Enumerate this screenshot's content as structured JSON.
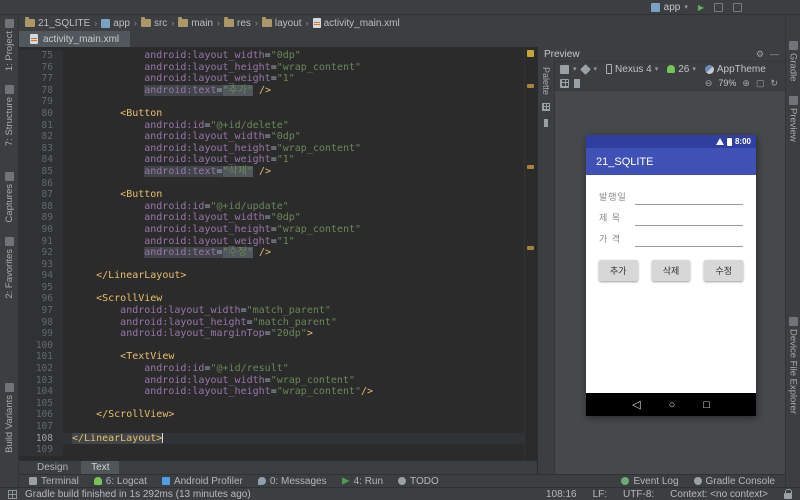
{
  "glyphs": {
    "chevron_down": "▾",
    "separator": "›",
    "play": "▶",
    "gear": "⚙",
    "minimize": "—",
    "zoom_out": "⊖",
    "zoom_in": "⊕",
    "frame": "▢",
    "refresh": "↻",
    "back": "◁",
    "home": "○",
    "recents": "□"
  },
  "top_bar": {
    "run_config": "app"
  },
  "breadcrumb": {
    "separator": "›",
    "items": [
      {
        "label": "21_SQLITE",
        "icon": "project-folder"
      },
      {
        "label": "app",
        "icon": "module"
      },
      {
        "label": "src",
        "icon": "folder"
      },
      {
        "label": "main",
        "icon": "folder"
      },
      {
        "label": "res",
        "icon": "folder"
      },
      {
        "label": "layout",
        "icon": "folder"
      },
      {
        "label": "activity_main.xml",
        "icon": "xml-file"
      }
    ]
  },
  "editor_tabs": {
    "active_tab": "activity_main.xml"
  },
  "left_stripe": {
    "top": [
      "1: Project",
      "7: Structure"
    ],
    "mid": [
      "Captures",
      "2: Favorites"
    ],
    "bottom": [
      "Build Variants"
    ]
  },
  "right_stripe": {
    "top": [
      "Gradle",
      "Preview"
    ],
    "bottom": [
      "Device File Explorer"
    ]
  },
  "editor": {
    "stripe_marks": [
      37,
      118,
      199
    ],
    "lines": [
      {
        "n": 75,
        "p": [
          [
            "i",
            12
          ],
          [
            "a",
            "android:layout_width"
          ],
          [
            "o",
            "="
          ],
          [
            "s",
            "\"0dp\""
          ]
        ]
      },
      {
        "n": 76,
        "p": [
          [
            "i",
            12
          ],
          [
            "a",
            "android:layout_height"
          ],
          [
            "o",
            "="
          ],
          [
            "s",
            "\"wrap_content\""
          ]
        ]
      },
      {
        "n": 77,
        "p": [
          [
            "i",
            12
          ],
          [
            "a",
            "android:layout_weight"
          ],
          [
            "o",
            "="
          ],
          [
            "s",
            "\"1\""
          ]
        ]
      },
      {
        "n": 78,
        "p": [
          [
            "i",
            12
          ],
          [
            "A",
            "android:text"
          ],
          [
            "O",
            "="
          ],
          [
            "S",
            "\"추가\""
          ],
          [
            "o",
            " "
          ],
          [
            "t",
            "/>"
          ]
        ]
      },
      {
        "n": 79,
        "p": []
      },
      {
        "n": 80,
        "p": [
          [
            "i",
            8
          ],
          [
            "t",
            "<Button"
          ]
        ]
      },
      {
        "n": 81,
        "p": [
          [
            "i",
            12
          ],
          [
            "a",
            "android:id"
          ],
          [
            "o",
            "="
          ],
          [
            "s",
            "\"@+id/delete\""
          ]
        ]
      },
      {
        "n": 82,
        "p": [
          [
            "i",
            12
          ],
          [
            "a",
            "android:layout_width"
          ],
          [
            "o",
            "="
          ],
          [
            "s",
            "\"0dp\""
          ]
        ]
      },
      {
        "n": 83,
        "p": [
          [
            "i",
            12
          ],
          [
            "a",
            "android:layout_height"
          ],
          [
            "o",
            "="
          ],
          [
            "s",
            "\"wrap_content\""
          ]
        ]
      },
      {
        "n": 84,
        "p": [
          [
            "i",
            12
          ],
          [
            "a",
            "android:layout_weight"
          ],
          [
            "o",
            "="
          ],
          [
            "s",
            "\"1\""
          ]
        ]
      },
      {
        "n": 85,
        "p": [
          [
            "i",
            12
          ],
          [
            "A",
            "android:text"
          ],
          [
            "O",
            "="
          ],
          [
            "S",
            "\"삭제\""
          ],
          [
            "o",
            " "
          ],
          [
            "t",
            "/>"
          ]
        ]
      },
      {
        "n": 86,
        "p": []
      },
      {
        "n": 87,
        "p": [
          [
            "i",
            8
          ],
          [
            "t",
            "<Button"
          ]
        ]
      },
      {
        "n": 88,
        "p": [
          [
            "i",
            12
          ],
          [
            "a",
            "android:id"
          ],
          [
            "o",
            "="
          ],
          [
            "s",
            "\"@+id/update\""
          ]
        ]
      },
      {
        "n": 89,
        "p": [
          [
            "i",
            12
          ],
          [
            "a",
            "android:layout_width"
          ],
          [
            "o",
            "="
          ],
          [
            "s",
            "\"0dp\""
          ]
        ]
      },
      {
        "n": 90,
        "p": [
          [
            "i",
            12
          ],
          [
            "a",
            "android:layout_height"
          ],
          [
            "o",
            "="
          ],
          [
            "s",
            "\"wrap_content\""
          ]
        ]
      },
      {
        "n": 91,
        "p": [
          [
            "i",
            12
          ],
          [
            "a",
            "android:layout_weight"
          ],
          [
            "o",
            "="
          ],
          [
            "s",
            "\"1\""
          ]
        ]
      },
      {
        "n": 92,
        "p": [
          [
            "i",
            12
          ],
          [
            "A",
            "android:text"
          ],
          [
            "O",
            "="
          ],
          [
            "S",
            "\"수정\""
          ],
          [
            "o",
            " "
          ],
          [
            "t",
            "/>"
          ]
        ]
      },
      {
        "n": 93,
        "p": []
      },
      {
        "n": 94,
        "p": [
          [
            "i",
            4
          ],
          [
            "t",
            "</LinearLayout>"
          ]
        ]
      },
      {
        "n": 95,
        "p": []
      },
      {
        "n": 96,
        "p": [
          [
            "i",
            4
          ],
          [
            "t",
            "<ScrollView"
          ]
        ]
      },
      {
        "n": 97,
        "p": [
          [
            "i",
            8
          ],
          [
            "a",
            "android:layout_width"
          ],
          [
            "o",
            "="
          ],
          [
            "s",
            "\"match_parent\""
          ]
        ]
      },
      {
        "n": 98,
        "p": [
          [
            "i",
            8
          ],
          [
            "a",
            "android:layout_height"
          ],
          [
            "o",
            "="
          ],
          [
            "s",
            "\"match_parent\""
          ]
        ]
      },
      {
        "n": 99,
        "p": [
          [
            "i",
            8
          ],
          [
            "a",
            "android:layout_marginTop"
          ],
          [
            "o",
            "="
          ],
          [
            "s",
            "\"20dp\""
          ],
          [
            "t",
            ">"
          ]
        ]
      },
      {
        "n": 100,
        "p": []
      },
      {
        "n": 101,
        "p": [
          [
            "i",
            8
          ],
          [
            "t",
            "<TextView"
          ]
        ]
      },
      {
        "n": 102,
        "p": [
          [
            "i",
            12
          ],
          [
            "a",
            "android:id"
          ],
          [
            "o",
            "="
          ],
          [
            "s",
            "\"@+id/result\""
          ]
        ]
      },
      {
        "n": 103,
        "p": [
          [
            "i",
            12
          ],
          [
            "a",
            "android:layout_width"
          ],
          [
            "o",
            "="
          ],
          [
            "s",
            "\"wrap_content\""
          ]
        ]
      },
      {
        "n": 104,
        "p": [
          [
            "i",
            12
          ],
          [
            "a",
            "android:layout_height"
          ],
          [
            "o",
            "="
          ],
          [
            "s",
            "\"wrap_content\""
          ],
          [
            "t",
            "/>"
          ]
        ]
      },
      {
        "n": 105,
        "p": []
      },
      {
        "n": 106,
        "p": [
          [
            "i",
            4
          ],
          [
            "t",
            "</ScrollView>"
          ]
        ]
      },
      {
        "n": 107,
        "p": []
      },
      {
        "n": 108,
        "cur": true,
        "p": [
          [
            "T",
            "</LinearLayout>"
          ],
          [
            "k",
            0
          ]
        ]
      },
      {
        "n": 109,
        "p": []
      }
    ]
  },
  "bottom_tabs": [
    {
      "label": "Design",
      "active": false
    },
    {
      "label": "Text",
      "active": true
    }
  ],
  "tool_windows": {
    "left": [
      {
        "label": "Terminal",
        "icon": "terminal"
      },
      {
        "label": "6: Logcat",
        "icon": "logcat"
      },
      {
        "label": "Android Profiler",
        "icon": "profiler"
      },
      {
        "label": "0: Messages",
        "icon": "messages"
      },
      {
        "label": "4: Run",
        "icon": "run"
      },
      {
        "label": "TODO",
        "icon": "todo"
      }
    ],
    "right": [
      {
        "label": "Event Log",
        "icon": "event-log"
      },
      {
        "label": "Gradle Console",
        "icon": "gradle-console"
      }
    ]
  },
  "status_bar": {
    "message": "Gradle build finished in 1s 292ms (13 minutes ago)",
    "caret_position": "108:16",
    "line_separator": "LF:",
    "encoding": "UTF-8:",
    "context": "Context: <no context>"
  },
  "preview": {
    "panel_title": "Preview",
    "palette_label": "Palette",
    "device": "Nexus 4",
    "api_level": "26",
    "theme": "AppTheme",
    "zoom_level": "79%",
    "phone": {
      "status_time": "8:00",
      "app_title": "21_SQLITE",
      "form_fields": [
        {
          "label": "발행일"
        },
        {
          "label": "제 목"
        },
        {
          "label": "가 격"
        }
      ],
      "buttons": [
        "추가",
        "삭제",
        "수정"
      ]
    }
  }
}
